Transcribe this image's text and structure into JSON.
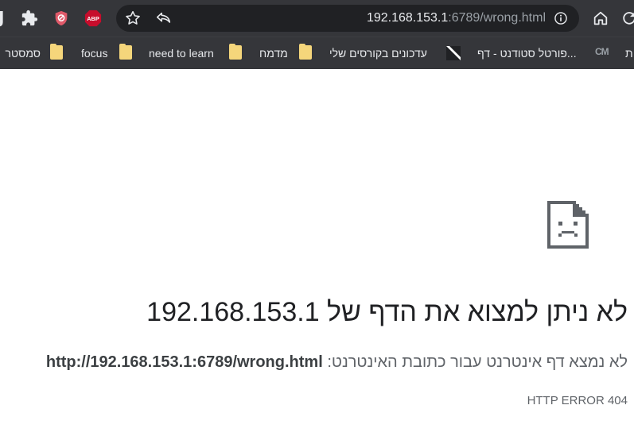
{
  "toolbar": {
    "partial_left_glyph": "J",
    "url": {
      "host": "192.168.153.1",
      "path": ":6789/wrong.html"
    },
    "extension_abp_label": "ABP"
  },
  "bookmarks": {
    "items": [
      {
        "label": "ת",
        "icon": "none"
      },
      {
        "label": "פורטל סטודנט - דף...",
        "icon": "cm-favicon"
      },
      {
        "label": "עדכונים בקורסים שלי",
        "icon": "moodle-favicon"
      },
      {
        "label": "מדמח",
        "icon": "folder-icon"
      },
      {
        "label": "need to learn",
        "icon": "folder-icon"
      },
      {
        "label": "focus",
        "icon": "folder-icon"
      },
      {
        "label": "סמסטר",
        "icon": "folder-icon"
      }
    ],
    "cm_favicon_text": "CM"
  },
  "error_page": {
    "title": "לא ניתן למצוא את הדף של 192.168.153.1",
    "description_prefix": "לא נמצא דף אינטרנט עבור כתובת האינטרנט:",
    "description_url": "http://192.168.153.1:6789/wrong.html",
    "code": "HTTP ERROR 404"
  },
  "colors": {
    "chrome_bg": "#35363a",
    "omnibox_bg": "#202124",
    "abp_red": "#c70d2c",
    "text_primary": "#202124",
    "text_secondary": "#5f6368"
  }
}
